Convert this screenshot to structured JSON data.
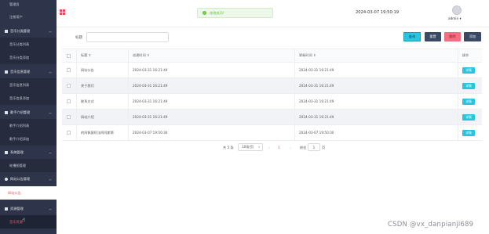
{
  "sidebar": {
    "items": [
      {
        "label": "管理员",
        "kind": "top"
      },
      {
        "label": "注册用户",
        "kind": "top"
      },
      {
        "label": "音乐分类管理",
        "kind": "group",
        "icon": "grid-icon",
        "expanded": true
      },
      {
        "label": "音乐分类列表",
        "kind": "child"
      },
      {
        "label": "音乐分类添加",
        "kind": "child"
      },
      {
        "label": "音乐信息管理",
        "kind": "group",
        "icon": "grid-icon",
        "expanded": true
      },
      {
        "label": "音乐信息列表",
        "kind": "child"
      },
      {
        "label": "音乐信息添加",
        "kind": "child"
      },
      {
        "label": "歌手介绍管理",
        "kind": "group",
        "icon": "grid-icon",
        "expanded": true
      },
      {
        "label": "歌手介绍列表",
        "kind": "child"
      },
      {
        "label": "歌手介绍添加",
        "kind": "child"
      },
      {
        "label": "系统管理",
        "kind": "group",
        "icon": "bar-chart-icon",
        "expanded": true
      },
      {
        "label": "轮播图管理",
        "kind": "child"
      },
      {
        "label": "网站公告管理",
        "kind": "group",
        "icon": "info-icon",
        "expanded": true
      },
      {
        "label": "网站公告",
        "kind": "child-active"
      },
      {
        "label": "资源管理",
        "kind": "group",
        "icon": "flag-icon",
        "expanded": true
      },
      {
        "label": "音乐资源",
        "kind": "child-selected"
      }
    ]
  },
  "header": {
    "toast": "修改成功!",
    "datetime": "2024-03-07 19:50:19",
    "user": "admin ▾"
  },
  "search": {
    "label": "标题",
    "value": ""
  },
  "buttons": {
    "query": "查询",
    "reset": "重置",
    "delete": "删除",
    "add": "添加"
  },
  "table": {
    "columns": [
      "标题 ⇕",
      "创建时间 ⇕",
      "更新时间 ⇕",
      "操作"
    ],
    "rows": [
      {
        "title": "网站公告",
        "created": "2024-03-31 16:21:49",
        "updated": "2024-03-31 16:21:49",
        "action": "详情"
      },
      {
        "title": "关于我们",
        "created": "2024-03-31 16:21:49",
        "updated": "2024-03-31 16:21:49",
        "action": "详情"
      },
      {
        "title": "联系方式",
        "created": "2024-03-31 16:21:49",
        "updated": "2024-03-31 16:21:49",
        "action": "详情"
      },
      {
        "title": "网站介绍",
        "created": "2024-03-31 16:21:49",
        "updated": "2024-03-31 16:21:49",
        "action": "详情"
      },
      {
        "title": "的阿佩瑟阿法阿阿斯蒂",
        "created": "2024-03-07 19:50:30",
        "updated": "2024-03-07 19:50:30",
        "action": "详情"
      }
    ]
  },
  "pagination": {
    "total": "共 5 条",
    "page_size": "10条/页",
    "prev": "‹",
    "current": "1",
    "next": "›",
    "goto": "前往",
    "goto_value": "1",
    "page_suffix": "页"
  },
  "watermark": "CSDN @vx_danpianji689",
  "colors": {
    "sidebar_bg": "#2e3449",
    "accent_red": "#f2455c",
    "cyan": "#29c4de",
    "dark_btn": "#3a4964",
    "success": "#67c23a"
  }
}
